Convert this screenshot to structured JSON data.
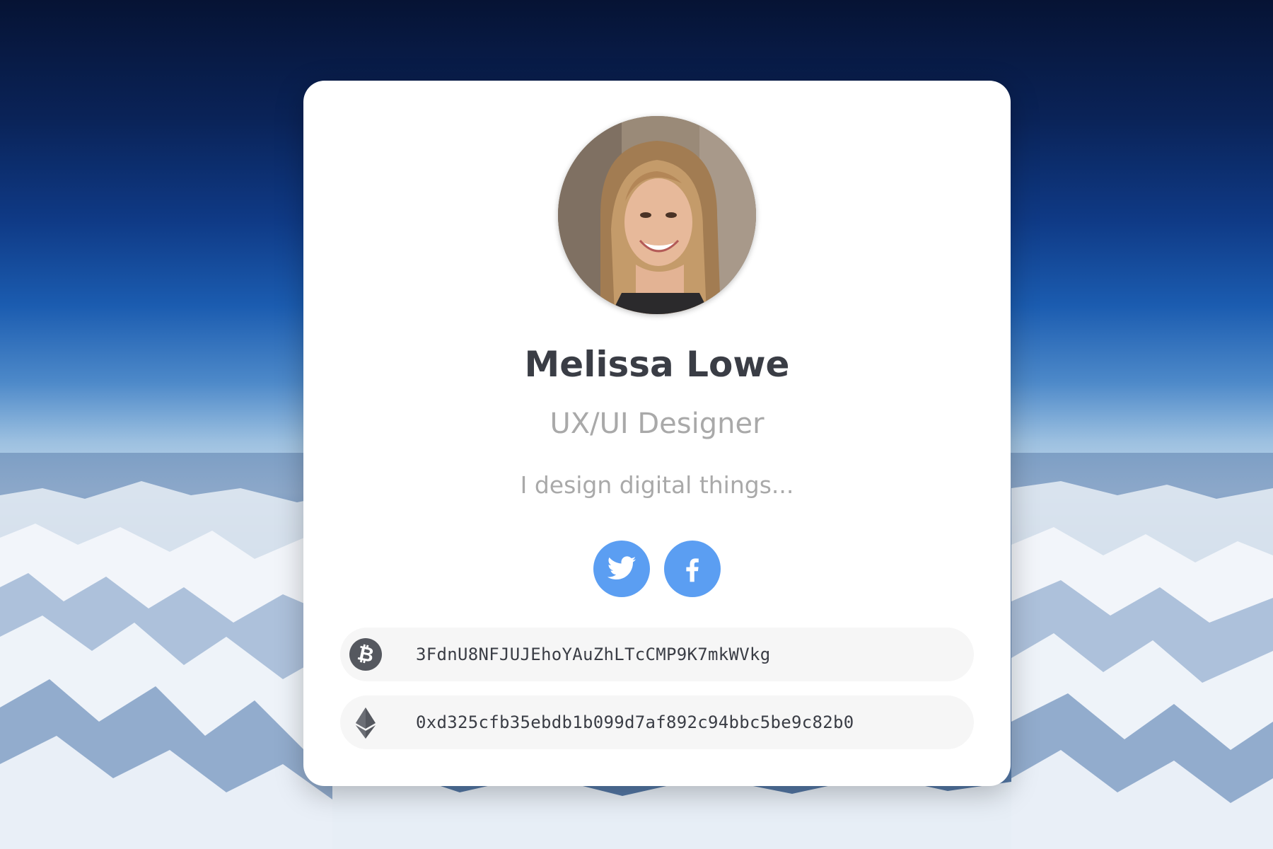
{
  "profile": {
    "name": "Melissa Lowe",
    "role": "UX/UI Designer",
    "bio": "I design digital things..."
  },
  "socials": [
    {
      "network": "twitter",
      "icon": "twitter-icon"
    },
    {
      "network": "facebook",
      "icon": "facebook-icon"
    }
  ],
  "wallets": {
    "bitcoin": {
      "icon": "bitcoin-icon",
      "address": "3FdnU8NFJUJEhoYAuZhLTcCMP9K7mkWVkg"
    },
    "ethereum": {
      "icon": "ethereum-icon",
      "address": "0xd325cfb35ebdb1b099d7af892c94bbc5be9c82b0"
    }
  },
  "colors": {
    "social_button": "#5b9ef2",
    "card": "#ffffff",
    "name_text": "#3a3d45",
    "muted_text": "#a9a9a9",
    "wallet_row": "#f6f6f6",
    "coin_icon": "#55585f"
  }
}
